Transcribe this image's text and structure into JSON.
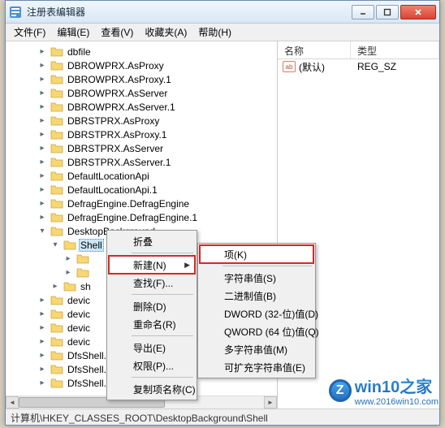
{
  "window": {
    "title": "注册表编辑器"
  },
  "menu": {
    "file": "文件(F)",
    "edit": "编辑(E)",
    "view": "查看(V)",
    "fav": "收藏夹(A)",
    "help": "帮助(H)"
  },
  "tree": {
    "items": [
      "dbfile",
      "DBROWPRX.AsProxy",
      "DBROWPRX.AsProxy.1",
      "DBROWPRX.AsServer",
      "DBROWPRX.AsServer.1",
      "DBRSTPRX.AsProxy",
      "DBRSTPRX.AsProxy.1",
      "DBRSTPRX.AsServer",
      "DBRSTPRX.AsServer.1",
      "DefaultLocationApi",
      "DefaultLocationApi.1",
      "DefragEngine.DefragEngine",
      "DefragEngine.DefragEngine.1",
      "DesktopBackground"
    ],
    "selected": "Shell",
    "sub_shell": "sh",
    "sub_items": [
      "devic",
      "devic",
      "devic",
      "devic"
    ],
    "tail_items": [
      "DfsShell.DfsShell",
      "DfsShell.DfsShell.1",
      "DfsShell.DfsShellAdmin"
    ]
  },
  "list": {
    "col_name": "名称",
    "col_type": "类型",
    "row_name": "(默认)",
    "row_type": "REG_SZ"
  },
  "ctx1": {
    "collapse": "折叠",
    "new": "新建(N)",
    "find": "查找(F)...",
    "delete": "删除(D)",
    "rename": "重命名(R)",
    "export": "导出(E)",
    "perm": "权限(P)...",
    "copykey": "复制项名称(C)"
  },
  "ctx2": {
    "key": "项(K)",
    "sz": "字符串值(S)",
    "bin": "二进制值(B)",
    "dword": "DWORD (32-位)值(D)",
    "qword": "QWORD (64 位)值(Q)",
    "multi": "多字符串值(M)",
    "expand": "可扩充字符串值(E)"
  },
  "status": "计算机\\HKEY_CLASSES_ROOT\\DesktopBackground\\Shell",
  "watermark": {
    "logo": "Z",
    "brand": "win10之家",
    "url": "www.2016win10.com"
  }
}
